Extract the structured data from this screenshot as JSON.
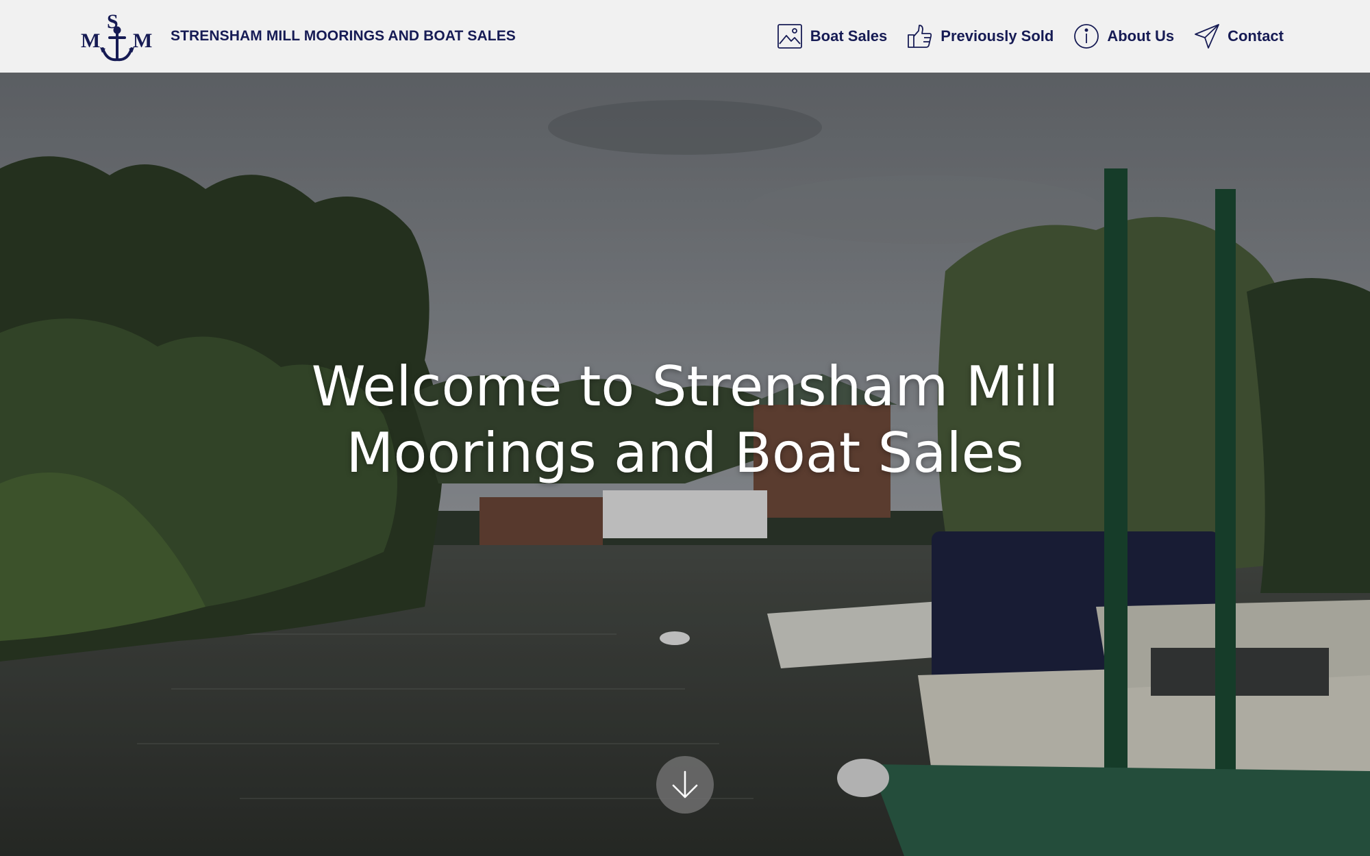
{
  "header": {
    "logo": {
      "letters": "MSM",
      "alt": "Strensham Mill Moorings logo"
    },
    "site_title": "STRENSHAM MILL MOORINGS AND BOAT SALES",
    "nav": [
      {
        "label": "Boat Sales",
        "icon": "image-icon"
      },
      {
        "label": "Previously Sold",
        "icon": "thumbs-up-icon"
      },
      {
        "label": "About Us",
        "icon": "info-icon"
      },
      {
        "label": "Contact",
        "icon": "send-icon"
      }
    ]
  },
  "hero": {
    "heading_line1": "Welcome to Strensham Mill",
    "heading_line2": "Moorings and Boat Sales",
    "scroll_icon": "arrow-down-icon"
  },
  "colors": {
    "header_bg": "#f1f1f1",
    "brand_navy": "#161b54",
    "hero_text": "#ffffff",
    "scroll_button": "#6e6e6e"
  }
}
